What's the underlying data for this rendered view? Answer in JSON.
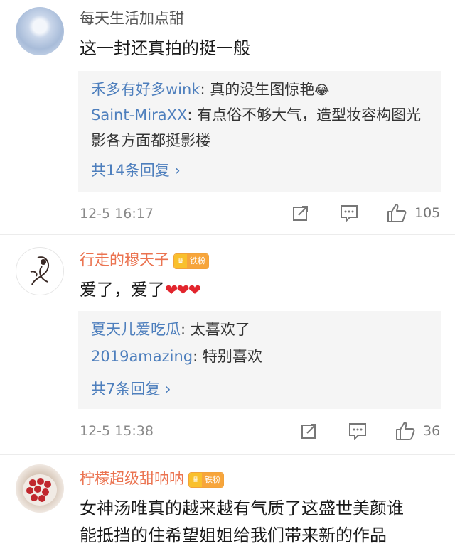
{
  "comments": [
    {
      "username": "每天生活加点甜",
      "text": "这一封还真拍的挺一般",
      "replies": [
        {
          "user": "禾多有好多wink",
          "text": ": 真的没生图惊艳",
          "emoji": "😂"
        },
        {
          "user": "Saint-MiraXX",
          "text": ": 有点俗不够大气，造型妆容构图光影各方面都挺影楼"
        }
      ],
      "more_replies": "共14条回复 ›",
      "time": "12-5 16:17",
      "likes": "105"
    },
    {
      "username": "行走的穆天子",
      "badge": "铁粉",
      "text": "爱了，爱了",
      "hearts": "❤❤❤",
      "replies": [
        {
          "user": "夏天儿爱吃瓜",
          "text": ": 太喜欢了"
        },
        {
          "user": "2019amazing",
          "text": ": 特别喜欢"
        }
      ],
      "more_replies": "共7条回复 ›",
      "time": "12-5 15:38",
      "likes": "36"
    },
    {
      "username": "柠檬超级甜呐呐",
      "badge": "铁粉",
      "text": "女神汤唯真的越来越有气质了这盛世美颜谁",
      "text2": "能抵挡的住希望姐姐给我们带来新的作品"
    }
  ]
}
